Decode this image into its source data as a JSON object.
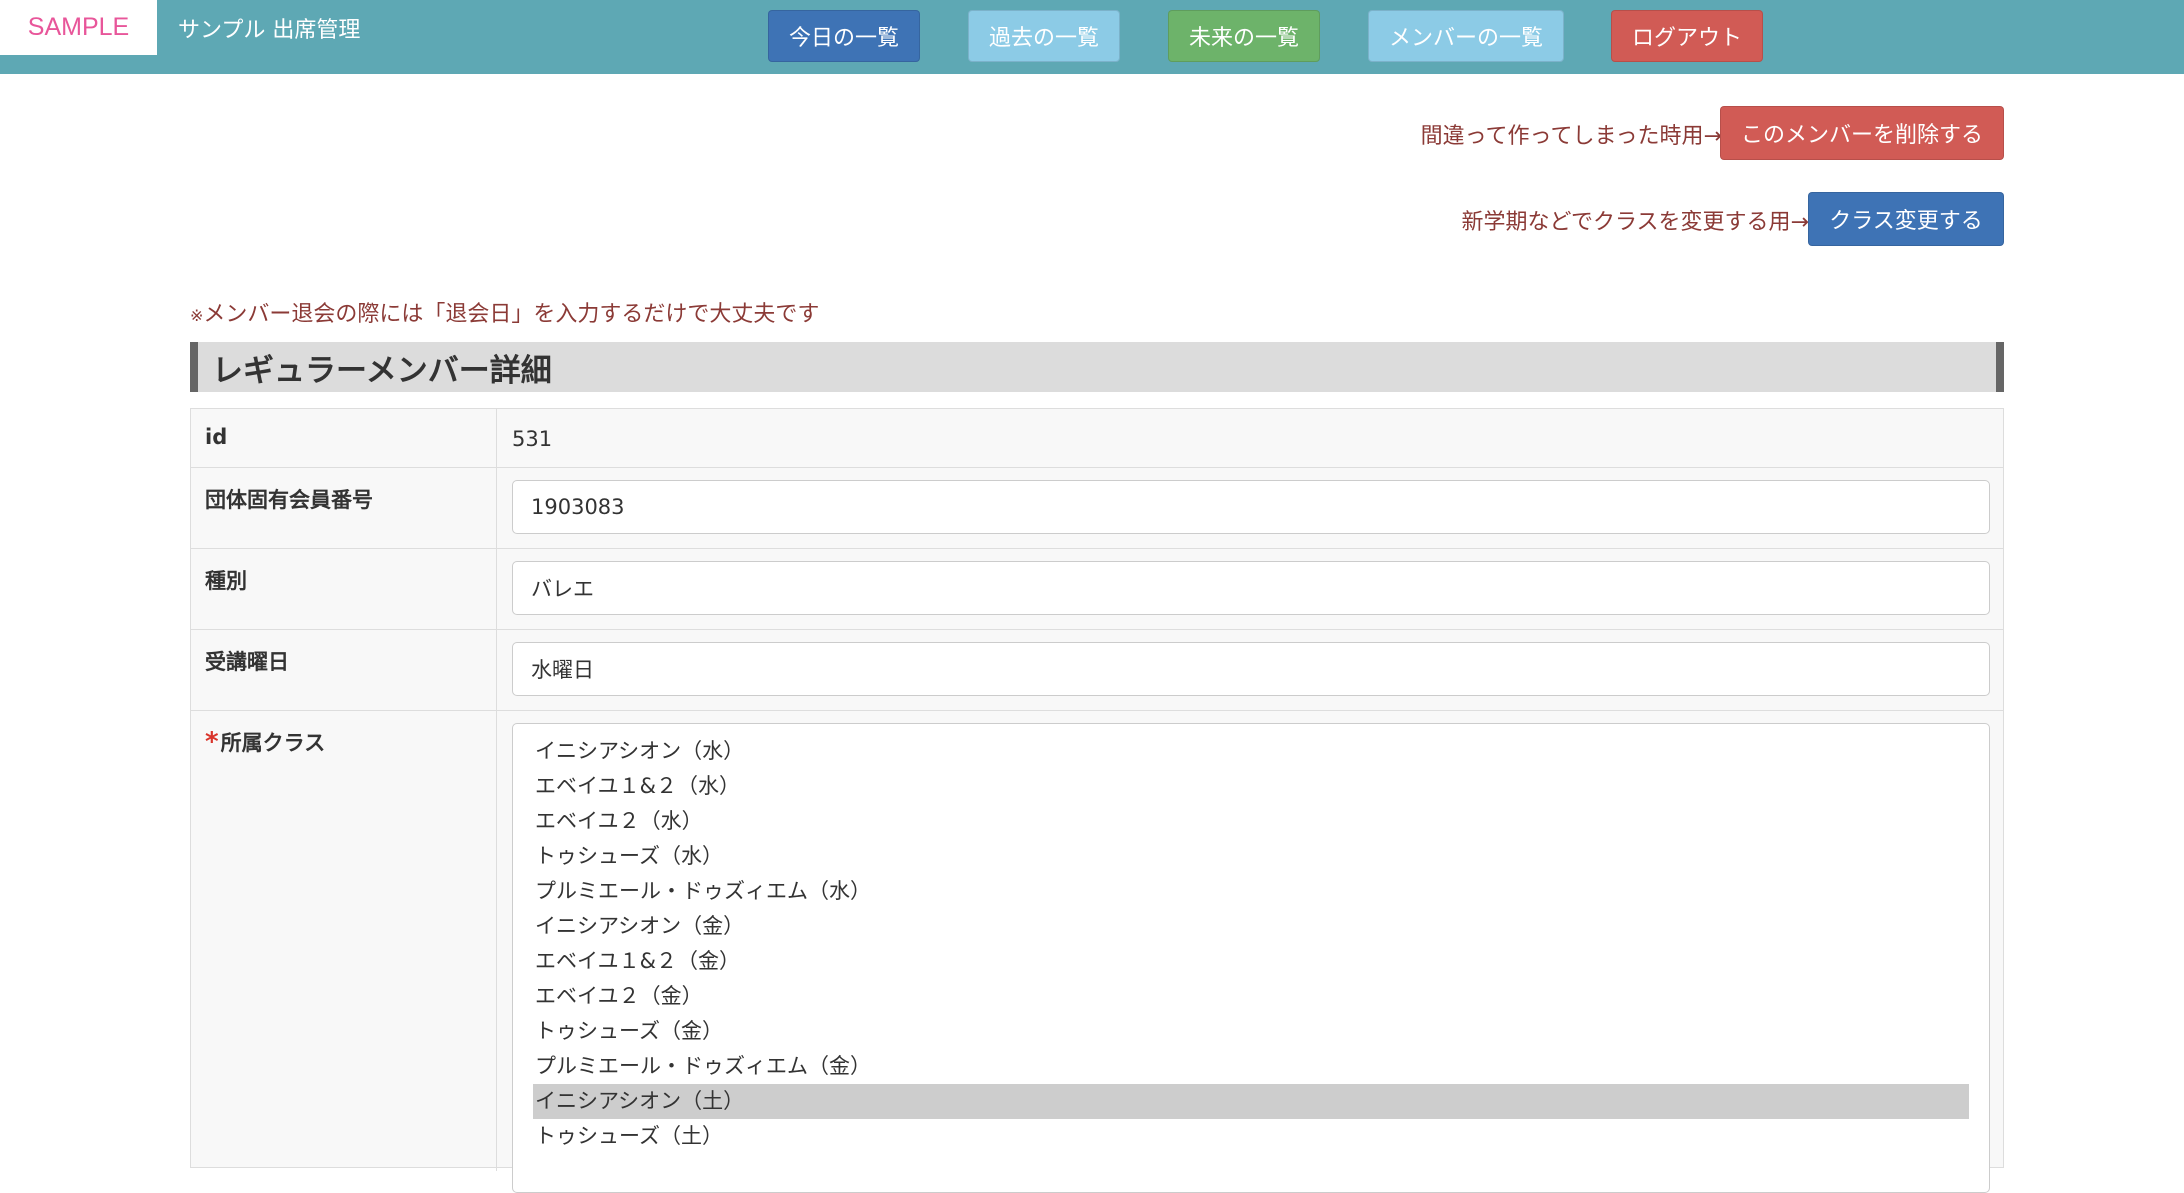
{
  "navbar": {
    "logo": "SAMPLE",
    "app_title": "サンプル 出席管理",
    "buttons": {
      "today": "今日の一覧",
      "past": "過去の一覧",
      "future": "未来の一覧",
      "members": "メンバーの一覧",
      "logout": "ログアウト"
    }
  },
  "actions": {
    "delete_hint": "間違って作ってしまった時用→",
    "delete_label": "このメンバーを削除する",
    "class_hint": "新学期などでクラスを変更する用→",
    "class_label": "クラス変更する"
  },
  "note": {
    "mark": "※",
    "text": "メンバー退会の際には「退会日」を入力するだけで大丈夫です"
  },
  "section": {
    "title": "レギュラーメンバー詳細"
  },
  "fields": {
    "id": {
      "label": "id",
      "value": "531"
    },
    "member_number": {
      "label": "団体固有会員番号",
      "value": "1903083"
    },
    "kind": {
      "label": "種別",
      "value": "バレエ"
    },
    "weekday": {
      "label": "受講曜日",
      "value": "水曜日"
    },
    "class": {
      "required_mark": "*",
      "label": "所属クラス",
      "options": [
        "イニシアシオン（水）",
        "エベイユ１&２（水）",
        "エベイユ２（水）",
        "トゥシューズ（水）",
        "プルミエール・ドゥズィエム（水）",
        "イニシアシオン（金）",
        "エベイユ１&２（金）",
        "エベイユ２（金）",
        "トゥシューズ（金）",
        "プルミエール・ドゥズィエム（金）",
        "イニシアシオン（土）",
        "トゥシューズ（土）"
      ],
      "selected": "イニシアシオン（土）"
    }
  },
  "colors": {
    "navbar": "#5ea8b4",
    "primary": "#3e73b5",
    "info": "#8ccbe6",
    "success": "#6db36a",
    "danger": "#d15b55",
    "logo": "#e8569a",
    "note_text": "#8b3a36"
  }
}
